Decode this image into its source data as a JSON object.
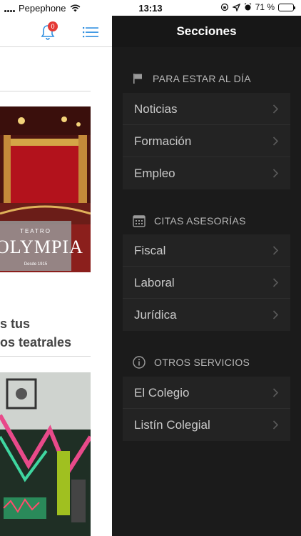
{
  "status_bar": {
    "carrier": "Pepephone",
    "time": "13:13",
    "battery": "71 %",
    "battery_level": 0.71
  },
  "content": {
    "notification_count": "0",
    "theatre_sign": {
      "small": "TEATRO",
      "big": "OLYMPIA",
      "est": "Desde 1915"
    },
    "headline_line1": "s tus",
    "headline_line2": "os teatrales"
  },
  "drawer": {
    "title": "Secciones",
    "sections": [
      {
        "icon": "flag-icon",
        "label": "PARA ESTAR AL DÍA",
        "items": [
          "Noticias",
          "Formación",
          "Empleo"
        ]
      },
      {
        "icon": "calendar-icon",
        "label": "CITAS ASESORÍAS",
        "items": [
          "Fiscal",
          "Laboral",
          "Jurídica"
        ]
      },
      {
        "icon": "info-icon",
        "label": "OTROS SERVICIOS",
        "items": [
          "El Colegio",
          "Listín Colegial"
        ]
      }
    ]
  },
  "colors": {
    "drawer_bg": "#1b1b1b",
    "row_bg": "#232323",
    "accent_blue": "#2f8fe0",
    "badge_red": "#e53935"
  }
}
